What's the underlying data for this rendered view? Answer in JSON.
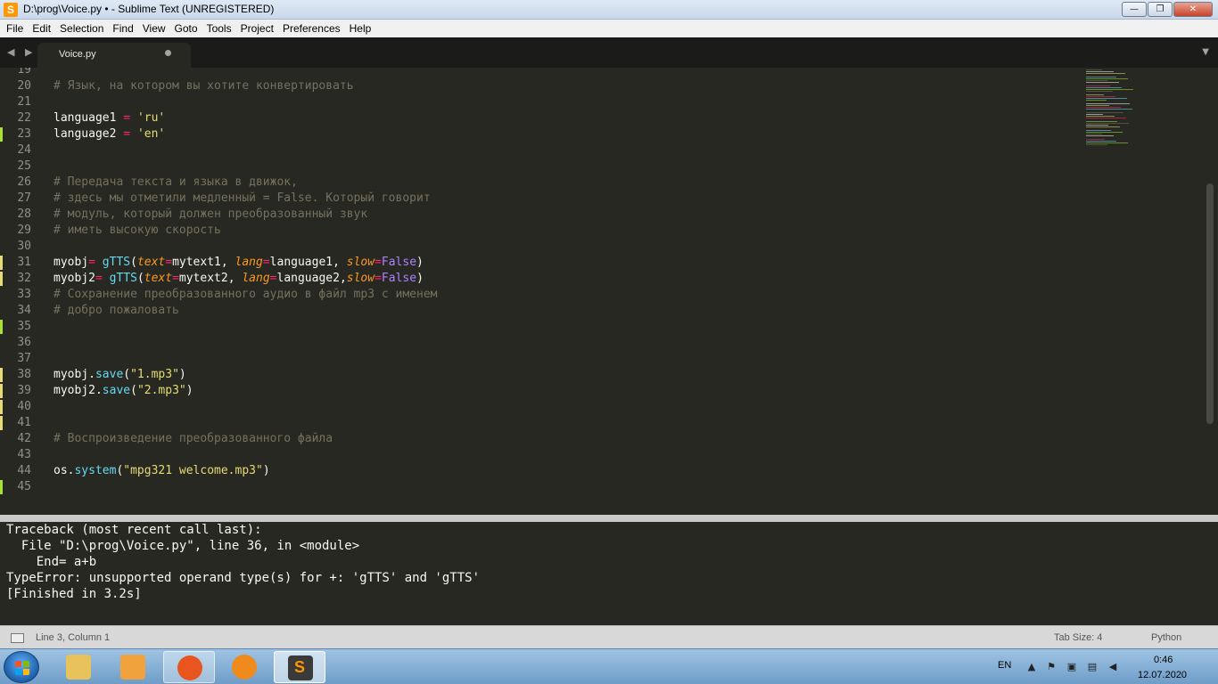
{
  "window": {
    "title": "D:\\prog\\Voice.py • - Sublime Text (UNREGISTERED)",
    "app_icon": "S",
    "buttons": {
      "minimize": "—",
      "maximize": "❐",
      "close": "✕"
    }
  },
  "menu": [
    "File",
    "Edit",
    "Selection",
    "Find",
    "View",
    "Goto",
    "Tools",
    "Project",
    "Preferences",
    "Help"
  ],
  "tabs": {
    "nav": "◀ ▶",
    "active": {
      "label": "Voice.py",
      "modified": true
    },
    "dropdown": "▼"
  },
  "editor": {
    "lines": [
      {
        "n": "19",
        "mark": "",
        "tokens": []
      },
      {
        "n": "20",
        "mark": "",
        "tokens": [
          {
            "t": "# Язык, на котором вы хотите конвертировать",
            "c": "c-comment"
          }
        ]
      },
      {
        "n": "21",
        "mark": "",
        "tokens": []
      },
      {
        "n": "22",
        "mark": "",
        "tokens": [
          {
            "t": "language1 ",
            "c": ""
          },
          {
            "t": "=",
            "c": "c-op"
          },
          {
            "t": " ",
            "c": ""
          },
          {
            "t": "'ru'",
            "c": "c-str"
          }
        ]
      },
      {
        "n": "23",
        "mark": "#a6e22e",
        "tokens": [
          {
            "t": "language2 ",
            "c": ""
          },
          {
            "t": "=",
            "c": "c-op"
          },
          {
            "t": " ",
            "c": ""
          },
          {
            "t": "'en'",
            "c": "c-str"
          }
        ]
      },
      {
        "n": "24",
        "mark": "",
        "tokens": []
      },
      {
        "n": "25",
        "mark": "",
        "tokens": []
      },
      {
        "n": "26",
        "mark": "",
        "tokens": [
          {
            "t": "# Передача текста и языка в движок,",
            "c": "c-comment"
          }
        ]
      },
      {
        "n": "27",
        "mark": "",
        "tokens": [
          {
            "t": "# здесь мы отметили медленный = False. Который говорит",
            "c": "c-comment"
          }
        ]
      },
      {
        "n": "28",
        "mark": "",
        "tokens": [
          {
            "t": "# модуль, который должен преобразованный звук",
            "c": "c-comment"
          }
        ]
      },
      {
        "n": "29",
        "mark": "",
        "tokens": [
          {
            "t": "# иметь высокую скорость",
            "c": "c-comment"
          }
        ]
      },
      {
        "n": "30",
        "mark": "",
        "tokens": []
      },
      {
        "n": "31",
        "mark": "#e6db74",
        "tokens": [
          {
            "t": "myobj",
            "c": ""
          },
          {
            "t": "=",
            "c": "c-op"
          },
          {
            "t": " ",
            "c": ""
          },
          {
            "t": "gTTS",
            "c": "c-fn"
          },
          {
            "t": "(",
            "c": ""
          },
          {
            "t": "text",
            "c": "c-arg"
          },
          {
            "t": "=",
            "c": "c-op"
          },
          {
            "t": "mytext1, ",
            "c": ""
          },
          {
            "t": "lang",
            "c": "c-arg"
          },
          {
            "t": "=",
            "c": "c-op"
          },
          {
            "t": "language1, ",
            "c": ""
          },
          {
            "t": "slow",
            "c": "c-arg"
          },
          {
            "t": "=",
            "c": "c-op"
          },
          {
            "t": "False",
            "c": "c-const"
          },
          {
            "t": ")",
            "c": ""
          }
        ]
      },
      {
        "n": "32",
        "mark": "#e6db74",
        "tokens": [
          {
            "t": "myobj2",
            "c": ""
          },
          {
            "t": "=",
            "c": "c-op"
          },
          {
            "t": " ",
            "c": ""
          },
          {
            "t": "gTTS",
            "c": "c-fn"
          },
          {
            "t": "(",
            "c": ""
          },
          {
            "t": "text",
            "c": "c-arg"
          },
          {
            "t": "=",
            "c": "c-op"
          },
          {
            "t": "mytext2, ",
            "c": ""
          },
          {
            "t": "lang",
            "c": "c-arg"
          },
          {
            "t": "=",
            "c": "c-op"
          },
          {
            "t": "language2,",
            "c": ""
          },
          {
            "t": "slow",
            "c": "c-arg"
          },
          {
            "t": "=",
            "c": "c-op"
          },
          {
            "t": "False",
            "c": "c-const"
          },
          {
            "t": ")",
            "c": ""
          }
        ]
      },
      {
        "n": "33",
        "mark": "",
        "tokens": [
          {
            "t": "# Сохранение преобразованного аудио в файл mp3 с именем",
            "c": "c-comment"
          }
        ]
      },
      {
        "n": "34",
        "mark": "",
        "tokens": [
          {
            "t": "# добро пожаловать",
            "c": "c-comment"
          }
        ]
      },
      {
        "n": "35",
        "mark": "#a6e22e",
        "tokens": []
      },
      {
        "n": "36",
        "mark": "",
        "tokens": []
      },
      {
        "n": "37",
        "mark": "",
        "tokens": []
      },
      {
        "n": "38",
        "mark": "#e6db74",
        "tokens": [
          {
            "t": "myobj.",
            "c": ""
          },
          {
            "t": "save",
            "c": "c-fn"
          },
          {
            "t": "(",
            "c": ""
          },
          {
            "t": "\"1.mp3\"",
            "c": "c-str"
          },
          {
            "t": ")",
            "c": ""
          }
        ]
      },
      {
        "n": "39",
        "mark": "#e6db74",
        "tokens": [
          {
            "t": "myobj2.",
            "c": ""
          },
          {
            "t": "save",
            "c": "c-fn"
          },
          {
            "t": "(",
            "c": ""
          },
          {
            "t": "\"2.mp3\"",
            "c": "c-str"
          },
          {
            "t": ")",
            "c": ""
          }
        ]
      },
      {
        "n": "40",
        "mark": "#e6db74",
        "tokens": []
      },
      {
        "n": "41",
        "mark": "#e6db74",
        "tokens": []
      },
      {
        "n": "42",
        "mark": "",
        "tokens": [
          {
            "t": "# Воспроизведение преобразованного файла",
            "c": "c-comment"
          }
        ]
      },
      {
        "n": "43",
        "mark": "",
        "tokens": []
      },
      {
        "n": "44",
        "mark": "",
        "tokens": [
          {
            "t": "os.",
            "c": ""
          },
          {
            "t": "system",
            "c": "c-fn"
          },
          {
            "t": "(",
            "c": ""
          },
          {
            "t": "\"mpg321 welcome.mp3\"",
            "c": "c-str"
          },
          {
            "t": ")",
            "c": ""
          }
        ]
      },
      {
        "n": "45",
        "mark": "#a6e22e",
        "tokens": []
      }
    ]
  },
  "console": {
    "lines": [
      "Traceback (most recent call last):",
      "  File \"D:\\prog\\Voice.py\", line 36, in <module>",
      "    End= a+b",
      "TypeError: unsupported operand type(s) for +: 'gTTS' and 'gTTS'",
      "[Finished in 3.2s]"
    ]
  },
  "status": {
    "position": "Line 3, Column 1",
    "tab_size": "Tab Size: 4",
    "syntax": "Python"
  },
  "taskbar": {
    "apps": [
      {
        "name": "explorer",
        "icon": "folder-icon",
        "color": "#e8c25a"
      },
      {
        "name": "media-player",
        "icon": "media-player-icon",
        "color": "#f0a23c"
      },
      {
        "name": "firefox",
        "icon": "firefox-icon",
        "color": "#e8551e"
      },
      {
        "name": "uc-browser",
        "icon": "uc-browser-icon",
        "color": "#f08a1c"
      },
      {
        "name": "sublime-text",
        "icon": "sublime-text-icon",
        "color": "#ff9800"
      }
    ],
    "tray": {
      "language": "EN",
      "time": "0:46",
      "date": "12.07.2020"
    }
  }
}
